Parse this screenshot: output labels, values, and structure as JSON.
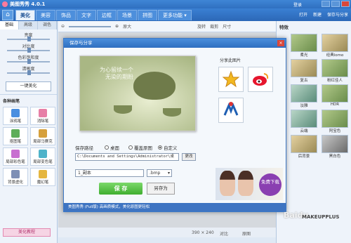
{
  "app": {
    "title": "美图秀秀 4.0.1",
    "login": "登录"
  },
  "tabs": [
    "美化",
    "美容",
    "饰品",
    "文字",
    "边框",
    "场景",
    "拼图",
    "更多功能 ▾"
  ],
  "top_right": [
    "打开",
    "新建",
    "保存与分享"
  ],
  "left": {
    "subtabs": [
      "基础",
      "高级",
      "调色"
    ],
    "sliders": [
      "亮度",
      "对比度",
      "色彩饱和度",
      "清晰度"
    ],
    "one_click": "一键美化",
    "section": "各种画笔",
    "tools": [
      "涂鸦笔",
      "消除笔",
      "抠图笔",
      "局部马赛克",
      "局部彩色笔",
      "局部变色笔",
      "背景虚化",
      "魔幻笔"
    ],
    "tutorial": "美化教程"
  },
  "toolbar": {
    "zoom_label": "原大",
    "items": [
      "旋转",
      "裁剪",
      "尺寸"
    ]
  },
  "right": {
    "title": "特效",
    "effects": [
      "柔光",
      "经典lomo",
      "复古",
      "粉红佳人",
      "淡雅",
      "HDR",
      "云端",
      "阿宝色",
      "后背景",
      "黑白色"
    ]
  },
  "dialog": {
    "title": "保存与分享",
    "close": "×",
    "preview_caption_1": "为心留续一个",
    "preview_caption_2": "无染的期盼",
    "save_path_label": "保存路径",
    "radios": [
      "桌面",
      "覆盖原图",
      "自定义"
    ],
    "path": "C:\\Documents and Settings\\Administrator\\桌",
    "change": "更改",
    "filename": "1_副本",
    "ext": ".bmp",
    "save": "保 存",
    "save_as": "另存为",
    "share_label": "分享此图片",
    "ad_free": "免费下载",
    "footer": "美图秀秀 (Full版) 高画质模式，美化原图更轻松"
  },
  "status": {
    "dims": "390 × 240",
    "compare": "对比",
    "original": "原图"
  },
  "watermark": "Baidu",
  "brand": "MAKEUPPLUS"
}
